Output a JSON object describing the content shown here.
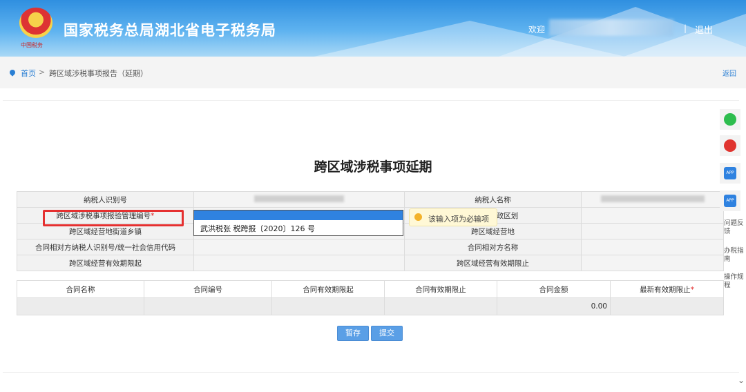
{
  "header": {
    "site_title": "国家税务总局湖北省电子税务局",
    "emblem_caption": "中国税务",
    "welcome": "欢迎",
    "separator": "|",
    "logout": "退出"
  },
  "breadcrumb": {
    "home": "首页",
    "arrow": ">",
    "current": "跨区域涉税事项报告（延期）",
    "back": "返回"
  },
  "form": {
    "title": "跨区域涉税事项延期",
    "rows": [
      {
        "left_label": "纳税人识别号",
        "right_label": "纳税人名称"
      },
      {
        "left_label": "跨区域涉税事项报验管理编号",
        "left_required": "*",
        "right_label": "跨区域行政区划"
      },
      {
        "left_label": "跨区域经营地街道乡镇",
        "right_label": "跨区域经营地"
      },
      {
        "left_label": "合同相对方纳税人识别号/统一社会信用代码",
        "right_label": "合同相对方名称"
      },
      {
        "left_label": "跨区域经营有效期限起",
        "right_label": "跨区域经营有效期限止"
      }
    ],
    "dropdown": {
      "selected": "",
      "option": "武洪税张 税跨报〔2020〕126 号"
    },
    "tooltip": "该输入项为必输项"
  },
  "contract_table": {
    "headers": [
      "合同名称",
      "合同编号",
      "合同有效期限起",
      "合同有效期限止",
      "合同金额",
      "最新有效期限止"
    ],
    "last_header_required": "*",
    "row": [
      "",
      "",
      "",
      "",
      "0.00",
      ""
    ]
  },
  "buttons": {
    "save": "暂存",
    "submit": "提交"
  },
  "sidebar": {
    "feedback": "问题反馈",
    "guide": "办税指南",
    "rules": "操作规程",
    "app_label": "APP"
  },
  "colors": {
    "accent": "#2f82e0",
    "highlight_border": "#e53030",
    "button": "#5a9fe6"
  }
}
